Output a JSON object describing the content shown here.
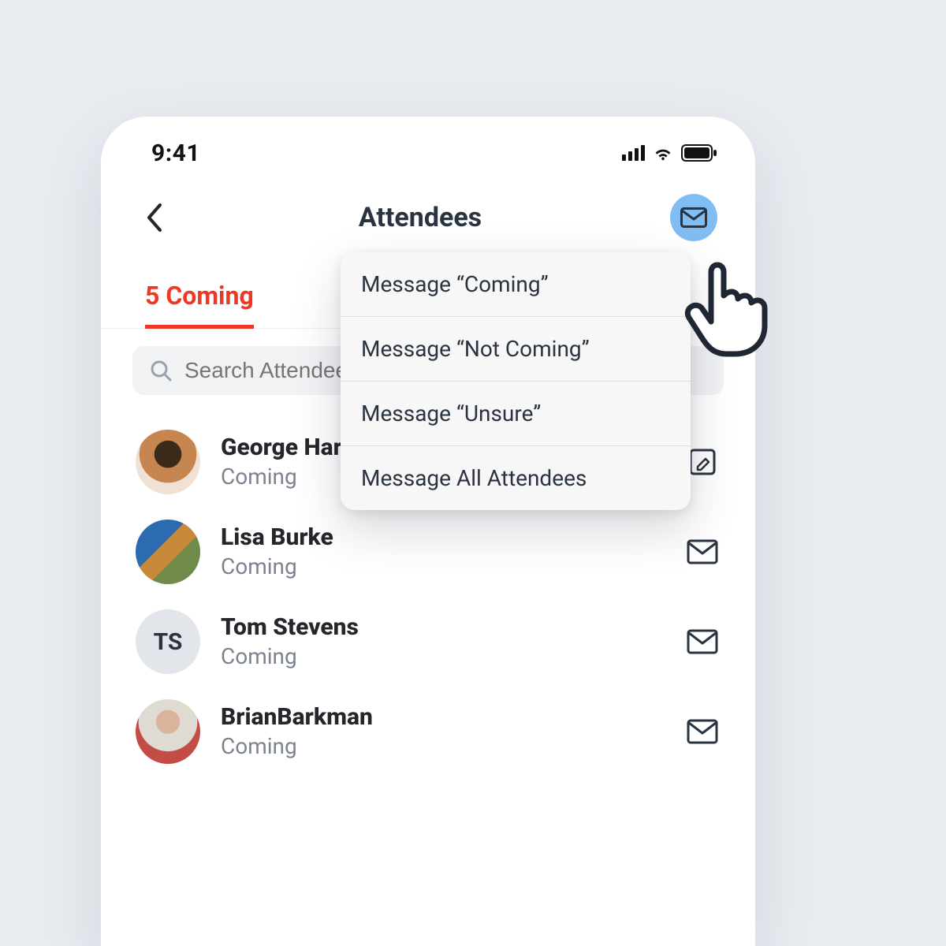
{
  "status": {
    "time": "9:41"
  },
  "header": {
    "title": "Attendees"
  },
  "tabs": {
    "coming_label": "5 Coming"
  },
  "search": {
    "placeholder": "Search Attendees"
  },
  "menu": {
    "items": [
      {
        "label": "Message “Coming”"
      },
      {
        "label": "Message “Not Coming”"
      },
      {
        "label": "Message “Unsure”"
      },
      {
        "label": "Message All Attendees"
      }
    ]
  },
  "attendees": [
    {
      "name": "George Harrison",
      "status": "Coming",
      "initials": "",
      "row_icon": "edit"
    },
    {
      "name": "Lisa Burke",
      "status": "Coming",
      "initials": "",
      "row_icon": "mail"
    },
    {
      "name": "Tom Stevens",
      "status": "Coming",
      "initials": "TS",
      "row_icon": "mail"
    },
    {
      "name": "BrianBarkman",
      "status": "Coming",
      "initials": "",
      "row_icon": "mail"
    }
  ],
  "colors": {
    "accent": "#ee3824",
    "highlight": "#7fbdf3"
  }
}
